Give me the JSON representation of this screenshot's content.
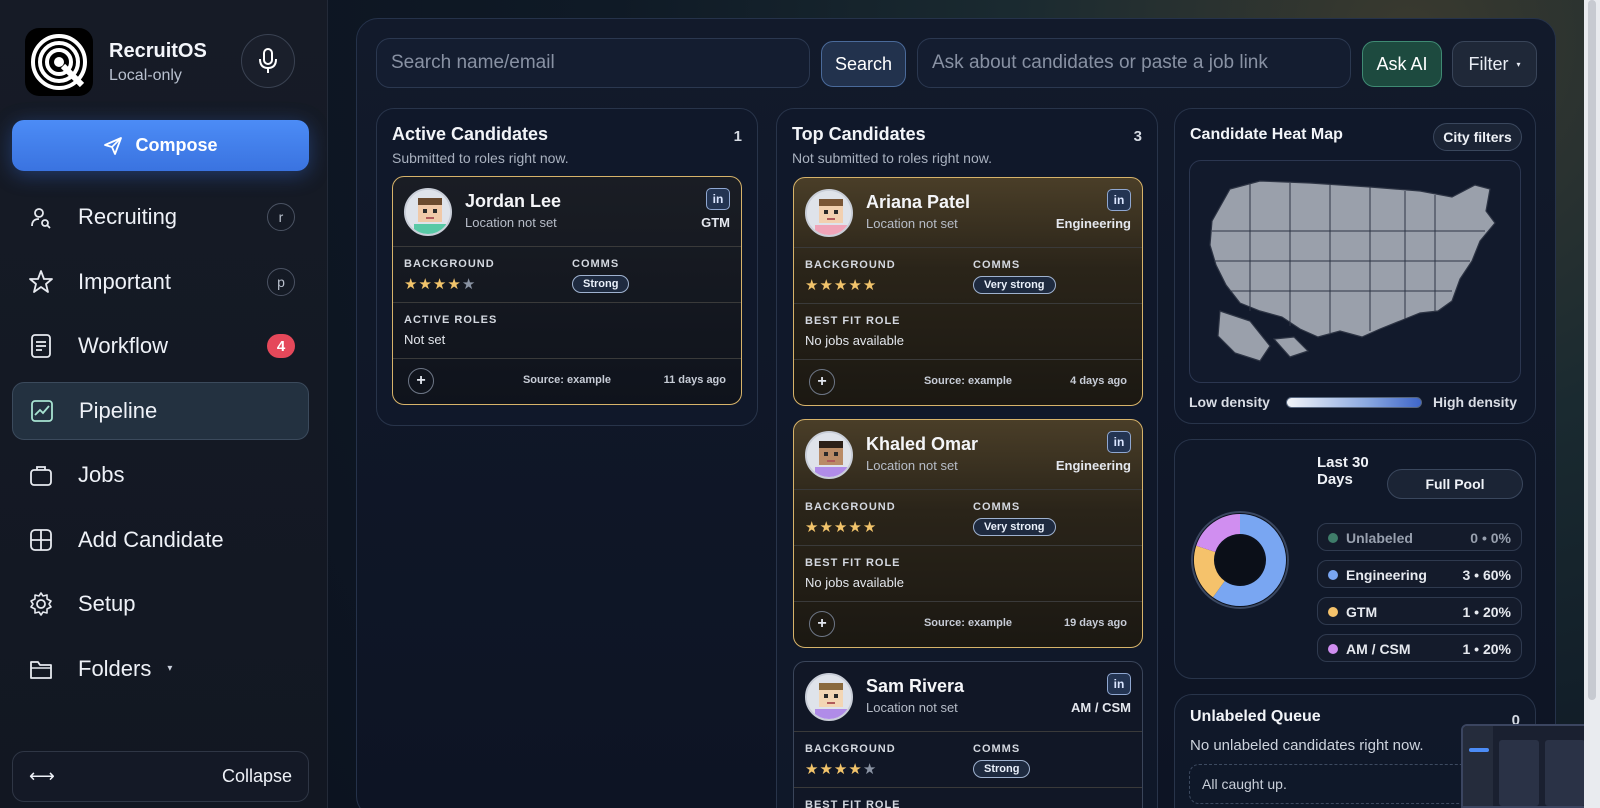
{
  "app": {
    "name": "RecruitOS",
    "subtitle": "Local-only",
    "compose_label": "Compose",
    "collapse_label": "Collapse",
    "collapse_glyph": "⟷"
  },
  "nav": {
    "items": [
      {
        "label": "Recruiting",
        "icon": "user-search-icon",
        "key": "r"
      },
      {
        "label": "Important",
        "icon": "star-icon",
        "key": "p"
      },
      {
        "label": "Workflow",
        "icon": "document-icon",
        "badge": "4"
      },
      {
        "label": "Pipeline",
        "icon": "chart-icon",
        "active": true
      },
      {
        "label": "Jobs",
        "icon": "briefcase-icon"
      },
      {
        "label": "Add Candidate",
        "icon": "grid-plus-icon"
      },
      {
        "label": "Setup",
        "icon": "gear-icon"
      },
      {
        "label": "Folders",
        "icon": "folder-icon",
        "caret": "▾"
      }
    ]
  },
  "toolbar": {
    "search_placeholder": "Search name/email",
    "search_label": "Search",
    "ask_placeholder": "Ask about candidates or paste a job link",
    "askai_label": "Ask AI",
    "filter_label": "Filter",
    "filter_caret": "▾"
  },
  "active": {
    "title": "Active Candidates",
    "subtitle": "Submitted to roles right now.",
    "count": "1",
    "cards": [
      {
        "name": "Jordan Lee",
        "location": "Location not set",
        "team": "GTM",
        "li": "in",
        "background_label": "BACKGROUND",
        "background_stars": 4,
        "comms_label": "COMMS",
        "comms": "Strong",
        "role_label": "ACTIVE ROLES",
        "role_value": "Not set",
        "source": "Source: example",
        "ago": "11 days ago",
        "plus": "+"
      }
    ]
  },
  "top": {
    "title": "Top Candidates",
    "subtitle": "Not submitted to roles right now.",
    "count": "3",
    "cards": [
      {
        "name": "Ariana Patel",
        "location": "Location not set",
        "team": "Engineering",
        "li": "in",
        "background_label": "BACKGROUND",
        "background_stars": 5,
        "comms_label": "COMMS",
        "comms": "Very strong",
        "role_label": "BEST FIT ROLE",
        "role_value": "No jobs available",
        "source": "Source: example",
        "ago": "4 days ago",
        "plus": "+"
      },
      {
        "name": "Khaled Omar",
        "location": "Location not set",
        "team": "Engineering",
        "li": "in",
        "background_label": "BACKGROUND",
        "background_stars": 5,
        "comms_label": "COMMS",
        "comms": "Very strong",
        "role_label": "BEST FIT ROLE",
        "role_value": "No jobs available",
        "source": "Source: example",
        "ago": "19 days ago",
        "plus": "+"
      },
      {
        "name": "Sam Rivera",
        "location": "Location not set",
        "team": "AM / CSM",
        "li": "in",
        "background_label": "BACKGROUND",
        "background_stars": 4,
        "comms_label": "COMMS",
        "comms": "Strong",
        "role_label": "BEST FIT ROLE"
      }
    ]
  },
  "heatmap": {
    "title": "Candidate Heat Map",
    "city_filters_label": "City filters",
    "low_label": "Low density",
    "high_label": "High density"
  },
  "pool": {
    "period_label": "Last 30 Days",
    "full_pool_label": "Full Pool",
    "segments": [
      {
        "name": "Unlabeled",
        "value": "0 • 0%",
        "count": 0,
        "color": "#3f7d6a"
      },
      {
        "name": "Engineering",
        "value": "3 • 60%",
        "count": 3,
        "color": "#79a6f2"
      },
      {
        "name": "GTM",
        "value": "1 • 20%",
        "count": 1,
        "color": "#f5c26b"
      },
      {
        "name": "AM / CSM",
        "value": "1 • 20%",
        "count": 1,
        "color": "#d08ef0"
      }
    ]
  },
  "queue": {
    "title": "Unlabeled Queue",
    "count": "0",
    "message": "No unlabeled candidates right now.",
    "empty_label": "All caught up."
  }
}
